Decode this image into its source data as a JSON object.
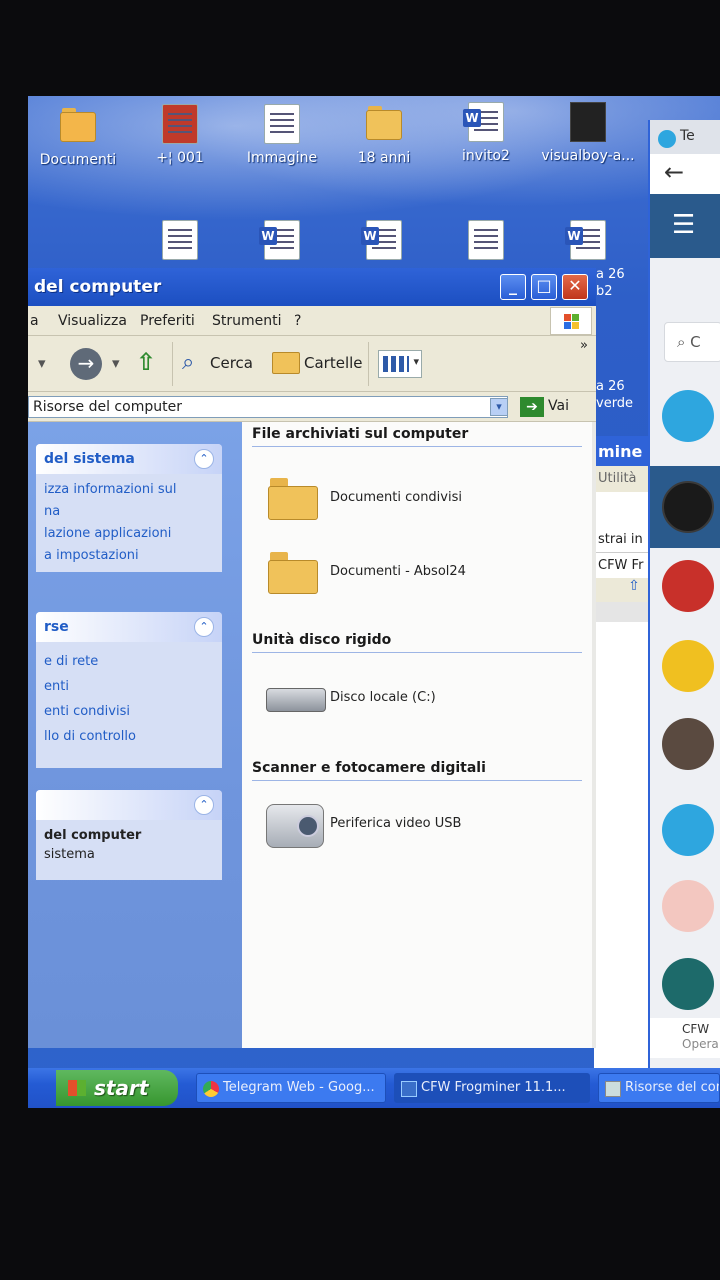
{
  "desktop": {
    "icons": [
      {
        "label": "Documenti",
        "kind": "folder-doc"
      },
      {
        "label": "+¦ 001",
        "kind": "image"
      },
      {
        "label": "Immagine",
        "kind": "image"
      },
      {
        "label": "18 anni",
        "kind": "folder"
      },
      {
        "label": "invito2",
        "kind": "word"
      },
      {
        "label": "visualboy-a...",
        "kind": "app"
      }
    ],
    "right_labels": [
      "a 26",
      "b2",
      "a 26",
      "verde"
    ]
  },
  "window": {
    "title": "del computer",
    "controls": {
      "minimize": "_",
      "maximize": "□",
      "close": "✕"
    },
    "menu": [
      "a",
      "Visualizza",
      "Preferiti",
      "Strumenti",
      "?"
    ],
    "toolbar": {
      "search": "Cerca",
      "folders": "Cartelle",
      "more": "»"
    },
    "address": {
      "value": "Risorse del computer",
      "go": "Vai"
    },
    "left_pane": [
      {
        "title": "del sistema",
        "items": [
          "izza informazioni sul",
          "na",
          "lazione applicazioni",
          "a impostazioni"
        ]
      },
      {
        "title": "rse",
        "items": [
          "e di rete",
          "enti",
          "enti condivisi",
          "llo di controllo"
        ]
      },
      {
        "title": "",
        "items": [
          "del computer",
          "sistema"
        ]
      }
    ],
    "groups": [
      {
        "title": "File archiviati sul computer",
        "items": [
          "Documenti condivisi",
          "Documenti - Absol24"
        ]
      },
      {
        "title": "Unità disco rigido",
        "items": [
          "Disco locale (C:)"
        ]
      },
      {
        "title": "Scanner e fotocamere digitali",
        "items": [
          "Periferica video USB"
        ]
      }
    ]
  },
  "background_window": {
    "title": "mine",
    "tab": "Utilità",
    "item1": "strai in",
    "item2": "CFW Fr"
  },
  "browser": {
    "tab": "Te",
    "search": "C",
    "footer_title": "CFW",
    "footer_sub": "Opera"
  },
  "taskbar": {
    "start": "start",
    "tasks": [
      "Telegram Web - Goog...",
      "CFW Frogminer 11.1...",
      "Risorse del com"
    ]
  },
  "colors": {
    "xp_blue": "#2f63d8",
    "start_green": "#37962f",
    "panel_blue": "#215dc6"
  }
}
